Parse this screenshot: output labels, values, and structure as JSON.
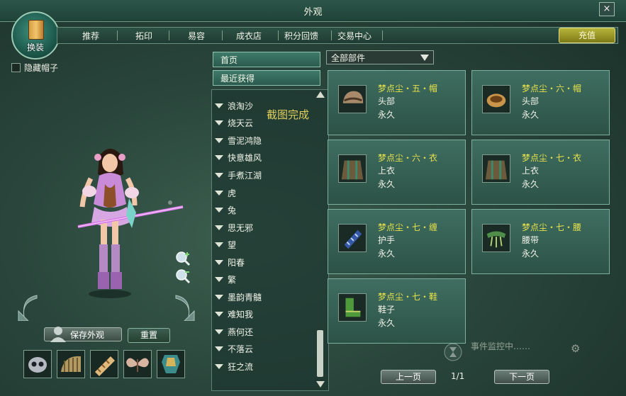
{
  "window": {
    "title": "外观",
    "close_glyph": "×"
  },
  "emblem": {
    "label": "换装"
  },
  "tabs": [
    {
      "label": "推荐"
    },
    {
      "label": "拓印"
    },
    {
      "label": "易容"
    },
    {
      "label": "成衣店"
    },
    {
      "label": "积分回馈"
    },
    {
      "label": "交易中心"
    }
  ],
  "recharge": {
    "label": "充值"
  },
  "hide_hat": {
    "label": "隐藏帽子",
    "checked": false
  },
  "actions": {
    "save_label": "保存外观",
    "reset_label": "重置"
  },
  "equip_slots": [
    "mask-icon",
    "shoulder-icon",
    "bracer-icon",
    "wings-icon",
    "armor-icon"
  ],
  "nav": {
    "home_label": "首页",
    "recent_label": "最近获得",
    "items": [
      {
        "label": "浪淘沙"
      },
      {
        "label": "烧天云"
      },
      {
        "label": "雪泥鸿隐"
      },
      {
        "label": "快意雄风"
      },
      {
        "label": "手煮江湖"
      },
      {
        "label": "虎"
      },
      {
        "label": "兔"
      },
      {
        "label": "思无邪"
      },
      {
        "label": "望"
      },
      {
        "label": "阳春"
      },
      {
        "label": "繁"
      },
      {
        "label": "墨韵青髓"
      },
      {
        "label": "难知我"
      },
      {
        "label": "燕何还"
      },
      {
        "label": "不落云"
      },
      {
        "label": "狂之流"
      }
    ]
  },
  "overlay": {
    "screenshot_done": "截图完成"
  },
  "filter": {
    "selected": "全部部件"
  },
  "items": [
    {
      "name": "梦点尘・五・帽",
      "slot": "头部",
      "duration": "永久",
      "icon": "hat-icon"
    },
    {
      "name": "梦点尘・六・帽",
      "slot": "头部",
      "duration": "永久",
      "icon": "hat-icon"
    },
    {
      "name": "梦点尘・六・衣",
      "slot": "上衣",
      "duration": "永久",
      "icon": "robe-icon"
    },
    {
      "name": "梦点尘・七・衣",
      "slot": "上衣",
      "duration": "永久",
      "icon": "robe-icon"
    },
    {
      "name": "梦点尘・七・缠",
      "slot": "护手",
      "duration": "永久",
      "icon": "gauntlet-icon"
    },
    {
      "name": "梦点尘・七・腰",
      "slot": "腰带",
      "duration": "永久",
      "icon": "belt-icon"
    },
    {
      "name": "梦点尘・七・鞋",
      "slot": "鞋子",
      "duration": "永久",
      "icon": "boots-icon"
    }
  ],
  "pager": {
    "prev_label": "上一页",
    "next_label": "下一页",
    "page": "1/1"
  },
  "event_monitor": {
    "text": "事件监控中……"
  }
}
